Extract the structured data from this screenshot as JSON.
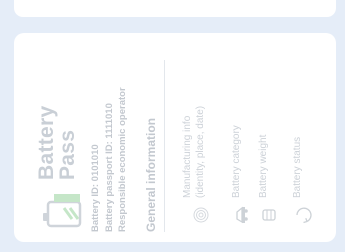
{
  "colors": {
    "background": "#e5edf8",
    "card": "#ffffff",
    "faded_text": "#c3c8cf",
    "accent": "#c5e6c8"
  },
  "brand": {
    "line1": "Battery",
    "line2": "Pass",
    "icon": "battery-icon"
  },
  "ids": {
    "battery_id": "Battery ID: 0101010",
    "passport_id": "Battery passport ID: 1111010",
    "operator": "Responsible economic operator"
  },
  "general_info": {
    "title": "General information",
    "items": [
      {
        "label": "Manufacturing info",
        "label2": "(identity, place, date)",
        "icon": "fingerprint-icon"
      },
      {
        "label": "Battery category",
        "icon": "vehicle-icon"
      },
      {
        "label": "Battery weight",
        "icon": "weight-icon"
      },
      {
        "label": "Battery status",
        "icon": "status-icon"
      }
    ]
  }
}
